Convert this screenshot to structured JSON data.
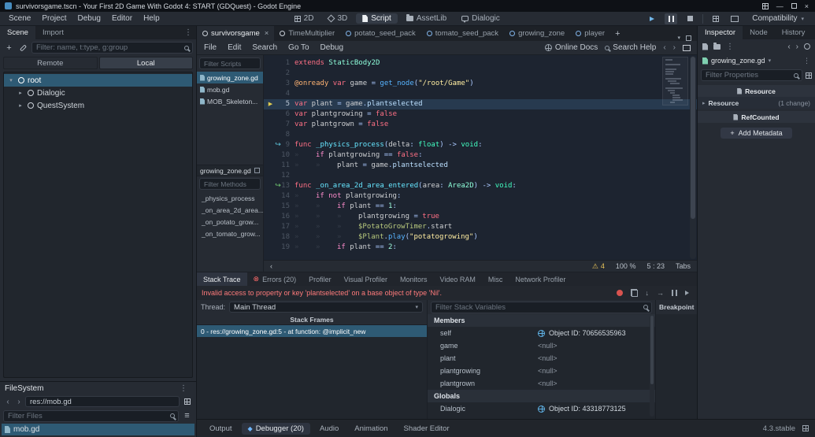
{
  "icons": {
    "warning": "⚠",
    "dots": "⋮",
    "chevron_left": "‹",
    "chevron_right": "›",
    "arrow_down": "▾",
    "arrow_right": "▸",
    "close": "×",
    "plus": "+",
    "minimize": "—",
    "step_into": "↓",
    "step_over": "→",
    "connection_mark": "↪",
    "exec_arrow": "▶",
    "error_dot": "⊗",
    "debug_diamond": "◆",
    "sort": "≡",
    "tab_mark": "»"
  },
  "titlebar": {
    "title": "survivorsgame.tscn - Your First 2D Game With Godot 4: START (GDQuest) - Godot Engine"
  },
  "menubar": {
    "menus": [
      "Scene",
      "Project",
      "Debug",
      "Editor",
      "Help"
    ],
    "workspaces": [
      {
        "label": "2D",
        "active": false
      },
      {
        "label": "3D",
        "active": false
      },
      {
        "label": "Script",
        "active": true
      },
      {
        "label": "AssetLib",
        "active": false
      },
      {
        "label": "Dialogic",
        "active": false
      }
    ],
    "renderer": "Compatibility"
  },
  "scene_dock": {
    "tabs": [
      {
        "label": "Scene",
        "active": true
      },
      {
        "label": "Import",
        "active": false
      }
    ],
    "filter_placeholder": "Filter: name, t:type, g:group",
    "view_buttons": [
      {
        "label": "Remote",
        "active": false
      },
      {
        "label": "Local",
        "active": true
      }
    ],
    "tree": [
      {
        "label": "root",
        "depth": 0,
        "selected": true,
        "expanded": true
      },
      {
        "label": "Dialogic",
        "depth": 1,
        "selected": false,
        "expanded": false
      },
      {
        "label": "QuestSystem",
        "depth": 1,
        "selected": false,
        "expanded": false
      }
    ]
  },
  "scene_tabs": {
    "tabs": [
      {
        "label": "survivorsgame",
        "active": true,
        "closable": true,
        "icon_color": "#c9cfd7"
      },
      {
        "label": "TimeMultiplier",
        "active": false,
        "icon_color": "#c9cfd7"
      },
      {
        "label": "potato_seed_pack",
        "active": false,
        "icon_color": "#80b3e8"
      },
      {
        "label": "tomato_seed_pack",
        "active": false,
        "icon_color": "#80b3e8"
      },
      {
        "label": "growing_zone",
        "active": false,
        "icon_color": "#80b3e8"
      },
      {
        "label": "player",
        "active": false,
        "icon_color": "#80b3e8"
      }
    ]
  },
  "script_editor": {
    "menus": [
      "File",
      "Edit",
      "Search",
      "Go To",
      "Debug"
    ],
    "online_docs": "Online Docs",
    "search_help": "Search Help",
    "filter_scripts_placeholder": "Filter Scripts",
    "scripts": [
      {
        "label": "growing_zone.gd",
        "selected": true
      },
      {
        "label": "mob.gd",
        "selected": false
      },
      {
        "label": "MOB_Skeleton...",
        "selected": false
      }
    ],
    "current_script_label": "growing_zone.gd",
    "filter_methods_placeholder": "Filter Methods",
    "methods": [
      "_physics_process",
      "_on_area_2d_area...",
      "_on_potato_grow...",
      "_on_tomato_grow..."
    ],
    "status": {
      "warnings": "4",
      "zoom": "100 %",
      "caret": "5 : 23",
      "indent": "Tabs"
    }
  },
  "code": {
    "lines": [
      {
        "n": 1,
        "tokens": [
          [
            "kw",
            "extends"
          ],
          [
            "txt",
            " "
          ],
          [
            "etype",
            "StaticBody2D"
          ]
        ]
      },
      {
        "n": 2,
        "tokens": []
      },
      {
        "n": 3,
        "tokens": [
          [
            "ann",
            "@onready"
          ],
          [
            "txt",
            " "
          ],
          [
            "kw",
            "var"
          ],
          [
            "txt",
            " game "
          ],
          [
            "sym",
            "="
          ],
          [
            "txt",
            " "
          ],
          [
            "fn",
            "get_node"
          ],
          [
            "sym",
            "("
          ],
          [
            "str",
            "\"/root/Game\""
          ],
          [
            "sym",
            ")"
          ]
        ]
      },
      {
        "n": 4,
        "tokens": []
      },
      {
        "n": 5,
        "exec": true,
        "tokens": [
          [
            "kw",
            "var"
          ],
          [
            "txt",
            " plant "
          ],
          [
            "sym",
            "="
          ],
          [
            "txt",
            " game"
          ],
          [
            "sym",
            "."
          ],
          [
            "mem",
            "plantselected"
          ]
        ]
      },
      {
        "n": 6,
        "tokens": [
          [
            "kw",
            "var"
          ],
          [
            "txt",
            " plantgrowing "
          ],
          [
            "sym",
            "="
          ],
          [
            "txt",
            " "
          ],
          [
            "kw",
            "false"
          ]
        ]
      },
      {
        "n": 7,
        "tokens": [
          [
            "kw",
            "var"
          ],
          [
            "txt",
            " plantgrown "
          ],
          [
            "sym",
            "="
          ],
          [
            "txt",
            " "
          ],
          [
            "kw",
            "false"
          ]
        ]
      },
      {
        "n": 8,
        "tokens": []
      },
      {
        "n": 9,
        "conn": "slot",
        "tokens": [
          [
            "kw",
            "func"
          ],
          [
            "txt",
            " "
          ],
          [
            "defn",
            "_physics_process"
          ],
          [
            "sym",
            "("
          ],
          [
            "txt",
            "delta"
          ],
          [
            "sym",
            ":"
          ],
          [
            "txt",
            " "
          ],
          [
            "type",
            "float"
          ],
          [
            "sym",
            ")"
          ],
          [
            "txt",
            " "
          ],
          [
            "sym",
            "->"
          ],
          [
            "txt",
            " "
          ],
          [
            "type",
            "void"
          ],
          [
            "sym",
            ":"
          ]
        ]
      },
      {
        "n": 10,
        "tokens": [
          [
            "tab",
            ""
          ],
          [
            "cf",
            "if"
          ],
          [
            "txt",
            " plantgrowing "
          ],
          [
            "sym",
            "=="
          ],
          [
            "txt",
            " "
          ],
          [
            "kw",
            "false"
          ],
          [
            "sym",
            ":"
          ]
        ]
      },
      {
        "n": 11,
        "tokens": [
          [
            "tab",
            ""
          ],
          [
            "tab",
            ""
          ],
          [
            "txt",
            "plant "
          ],
          [
            "sym",
            "="
          ],
          [
            "txt",
            " game"
          ],
          [
            "sym",
            "."
          ],
          [
            "mem",
            "plantselected"
          ]
        ]
      },
      {
        "n": 12,
        "tokens": []
      },
      {
        "n": 13,
        "conn": "signal",
        "tokens": [
          [
            "kw",
            "func"
          ],
          [
            "txt",
            " "
          ],
          [
            "defn",
            "_on_area_2d_area_entered"
          ],
          [
            "sym",
            "("
          ],
          [
            "txt",
            "area"
          ],
          [
            "sym",
            ":"
          ],
          [
            "txt",
            " "
          ],
          [
            "etype",
            "Area2D"
          ],
          [
            "sym",
            ")"
          ],
          [
            "txt",
            " "
          ],
          [
            "sym",
            "->"
          ],
          [
            "txt",
            " "
          ],
          [
            "type",
            "void"
          ],
          [
            "sym",
            ":"
          ]
        ]
      },
      {
        "n": 14,
        "tokens": [
          [
            "tab",
            ""
          ],
          [
            "cf",
            "if"
          ],
          [
            "txt",
            " "
          ],
          [
            "cf",
            "not"
          ],
          [
            "txt",
            " plantgrowing"
          ],
          [
            "sym",
            ":"
          ]
        ]
      },
      {
        "n": 15,
        "tokens": [
          [
            "tab",
            ""
          ],
          [
            "tab",
            ""
          ],
          [
            "cf",
            "if"
          ],
          [
            "txt",
            " plant "
          ],
          [
            "sym",
            "=="
          ],
          [
            "txt",
            " "
          ],
          [
            "num",
            "1"
          ],
          [
            "sym",
            ":"
          ]
        ]
      },
      {
        "n": 16,
        "tokens": [
          [
            "tab",
            ""
          ],
          [
            "tab",
            ""
          ],
          [
            "tab",
            ""
          ],
          [
            "txt",
            "plantgrowing "
          ],
          [
            "sym",
            "="
          ],
          [
            "txt",
            " "
          ],
          [
            "kw",
            "true"
          ]
        ]
      },
      {
        "n": 17,
        "tokens": [
          [
            "tab",
            ""
          ],
          [
            "tab",
            ""
          ],
          [
            "tab",
            ""
          ],
          [
            "node",
            "$PotatoGrowTimer"
          ],
          [
            "sym",
            "."
          ],
          [
            "txt",
            "start"
          ]
        ]
      },
      {
        "n": 18,
        "tokens": [
          [
            "tab",
            ""
          ],
          [
            "tab",
            ""
          ],
          [
            "tab",
            ""
          ],
          [
            "node",
            "$Plant"
          ],
          [
            "sym",
            "."
          ],
          [
            "fn",
            "play"
          ],
          [
            "sym",
            "("
          ],
          [
            "str",
            "\"potatogrowing\""
          ],
          [
            "sym",
            ")"
          ]
        ]
      },
      {
        "n": 19,
        "tokens": [
          [
            "tab",
            ""
          ],
          [
            "tab",
            ""
          ],
          [
            "cf",
            "if"
          ],
          [
            "txt",
            " plant "
          ],
          [
            "sym",
            "=="
          ],
          [
            "txt",
            " "
          ],
          [
            "num",
            "2"
          ],
          [
            "sym",
            ":"
          ]
        ]
      }
    ]
  },
  "debugger": {
    "tabs": [
      {
        "label": "Stack Trace",
        "active": true
      },
      {
        "label": "Errors (20)",
        "active": false,
        "icon": "error"
      },
      {
        "label": "Profiler",
        "active": false
      },
      {
        "label": "Visual Profiler",
        "active": false
      },
      {
        "label": "Monitors",
        "active": false
      },
      {
        "label": "Video RAM",
        "active": false
      },
      {
        "label": "Misc",
        "active": false
      },
      {
        "label": "Network Profiler",
        "active": false
      }
    ],
    "error_message": "Invalid access to property or key 'plantselected' on a base object of type 'Nil'.",
    "thread_label": "Thread:",
    "thread_value": "Main Thread",
    "stack_frames_header": "Stack Frames",
    "stack_frames": [
      {
        "label": "0 - res://growing_zone.gd:5 - at function: @implicit_new",
        "selected": true
      }
    ],
    "filter_placeholder": "Filter Stack Variables",
    "breakpoints_header": "Breakpoint",
    "variable_groups": [
      {
        "header": "Members",
        "rows": [
          {
            "name": "self",
            "value": "Object ID: 70656535963",
            "object": true
          },
          {
            "name": "game",
            "value": "<null>",
            "object": false
          },
          {
            "name": "plant",
            "value": "<null>",
            "object": false
          },
          {
            "name": "plantgrowing",
            "value": "<null>",
            "object": false
          },
          {
            "name": "plantgrown",
            "value": "<null>",
            "object": false
          }
        ]
      },
      {
        "header": "Globals",
        "rows": [
          {
            "name": "Dialogic",
            "value": "Object ID: 43318773125",
            "object": true
          }
        ]
      }
    ]
  },
  "filesystem": {
    "title": "FileSystem",
    "path": "res://mob.gd",
    "filter_placeholder": "Filter Files",
    "files": [
      {
        "label": "mob.gd",
        "selected": true
      }
    ]
  },
  "inspector": {
    "tabs": [
      {
        "label": "Inspector",
        "active": true
      },
      {
        "label": "Node",
        "active": false
      },
      {
        "label": "History",
        "active": false
      }
    ],
    "resource_name": "growing_zone.gd",
    "filter_placeholder": "Filter Properties",
    "category_resource": "Resource",
    "section_resource": {
      "label": "Resource",
      "badge": "(1 change)"
    },
    "category_refcounted": "RefCounted",
    "add_metadata_label": "Add Metadata"
  },
  "bottom_bar": {
    "items": [
      {
        "label": "Output",
        "active": false,
        "icon": null
      },
      {
        "label": "Debugger (20)",
        "active": true,
        "icon": "debug"
      },
      {
        "label": "Audio",
        "active": false,
        "icon": null
      },
      {
        "label": "Animation",
        "active": false,
        "icon": null
      },
      {
        "label": "Shader Editor",
        "active": false,
        "icon": null
      }
    ],
    "version": "4.3.stable"
  }
}
